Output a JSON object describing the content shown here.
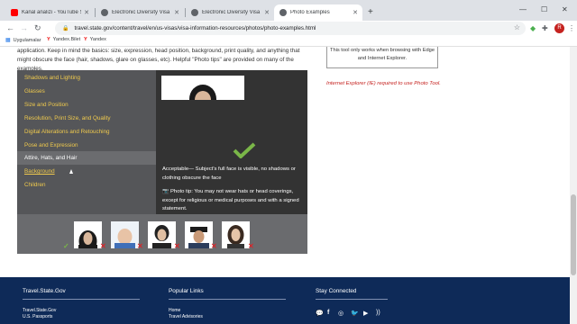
{
  "browser": {
    "tabs": [
      {
        "label": "Kanal analizi - YouTube Studio",
        "favicon_color": "#ff0000"
      },
      {
        "label": "Electronic Diversity Visa Program",
        "favicon_color": "#5f6368"
      },
      {
        "label": "Electronic Diversity Visa Program",
        "favicon_color": "#5f6368"
      },
      {
        "label": "Photo Examples",
        "favicon_color": "#5f6368"
      }
    ],
    "new_tab": "+",
    "url": "travel.state.gov/content/travel/en/us-visas/visa-information-resources/photos/photo-examples.html",
    "avatar_letter": "R",
    "bookmarks": [
      {
        "label": "Uygulamalar",
        "icon": "apps-grid-icon"
      },
      {
        "label": "Yandex.Bilet",
        "icon": "yandex-icon"
      },
      {
        "label": "Yandex",
        "icon": "yandex-icon"
      }
    ]
  },
  "page": {
    "intro_text": "application. Keep in mind the basics: size, expression, head position, background, print quality, and anything that might obscure the face (hair, shadows, glare on glasses, etc). Helpful \"Photo tips\" are provided on many of the examples.",
    "menu": [
      "Shadows and Lighting",
      "Glasses",
      "Size and Position",
      "Resolution, Print Size, and Quality",
      "Digital Alterations and Retouching",
      "Pose and Expression",
      "Attire, Hats, and Hair",
      "Background",
      "Children"
    ],
    "acceptable_text": "Acceptable— Subject's full face is visible, no shadows or clothing obscure the face",
    "photo_tip_text": "Photo tip: You may not wear hats or head coverings, except for religious or medical purposes and with a signed statement.",
    "sidebox_text": "This tool only works when browsing with Edge and Internet Explorer.",
    "ie_note": "Internet Explorer (IE) required to use Photo Tool.",
    "accent_yellow": "#f0ca4d",
    "check_green": "#7ab648",
    "cross_red": "#d9262b"
  },
  "footer": {
    "col1_title": "Travel.State.Gov",
    "col1_links": [
      "Travel.State.Gov",
      "U.S. Passports"
    ],
    "col2_title": "Popular Links",
    "col2_links": [
      "Home",
      "Travel Advisories"
    ],
    "col3_title": "Stay Connected",
    "social_icons": [
      "chat-icon",
      "facebook-icon",
      "instagram-icon",
      "twitter-icon",
      "youtube-icon",
      "rss-icon"
    ],
    "bg_color": "#0e2a58"
  }
}
